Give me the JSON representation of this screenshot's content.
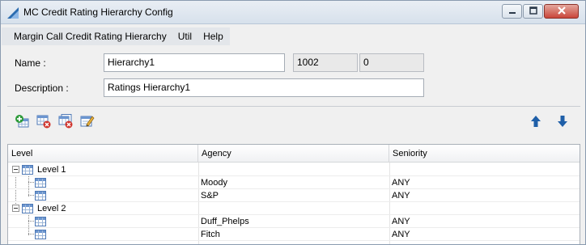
{
  "window": {
    "title": "MC Credit Rating Hierarchy Config",
    "icon": "app-logo-icon",
    "controls": [
      "minimize-icon",
      "maximize-icon",
      "close-icon"
    ]
  },
  "menu": {
    "items": [
      "Margin Call Credit Rating Hierarchy",
      "Util",
      "Help"
    ]
  },
  "form": {
    "name_label": "Name :",
    "name_value": "Hierarchy1",
    "id_value": "1002",
    "version_value": "0",
    "description_label": "Description :",
    "description_value": "Ratings Hierarchy1"
  },
  "toolbar": {
    "buttons": [
      "add-icon",
      "delete-icon",
      "delete-all-icon",
      "edit-icon",
      "move-up-icon",
      "move-down-icon"
    ]
  },
  "grid": {
    "columns": [
      "Level",
      "Agency",
      "Seniority"
    ],
    "rows": [
      {
        "level": "Level 1",
        "agency": "",
        "seniority": ""
      },
      {
        "level": "",
        "agency": "Moody",
        "seniority": "ANY"
      },
      {
        "level": "",
        "agency": "S&P",
        "seniority": "ANY"
      },
      {
        "level": "Level 2",
        "agency": "",
        "seniority": ""
      },
      {
        "level": "",
        "agency": "Duff_Phelps",
        "seniority": "ANY"
      },
      {
        "level": "",
        "agency": "Fitch",
        "seniority": "ANY"
      }
    ]
  },
  "colors": {
    "title_bar": "#dbe4ee",
    "close_button": "#c9463a",
    "arrow_blue": "#1f5fa8",
    "window_bg": "#f0f0f0"
  }
}
